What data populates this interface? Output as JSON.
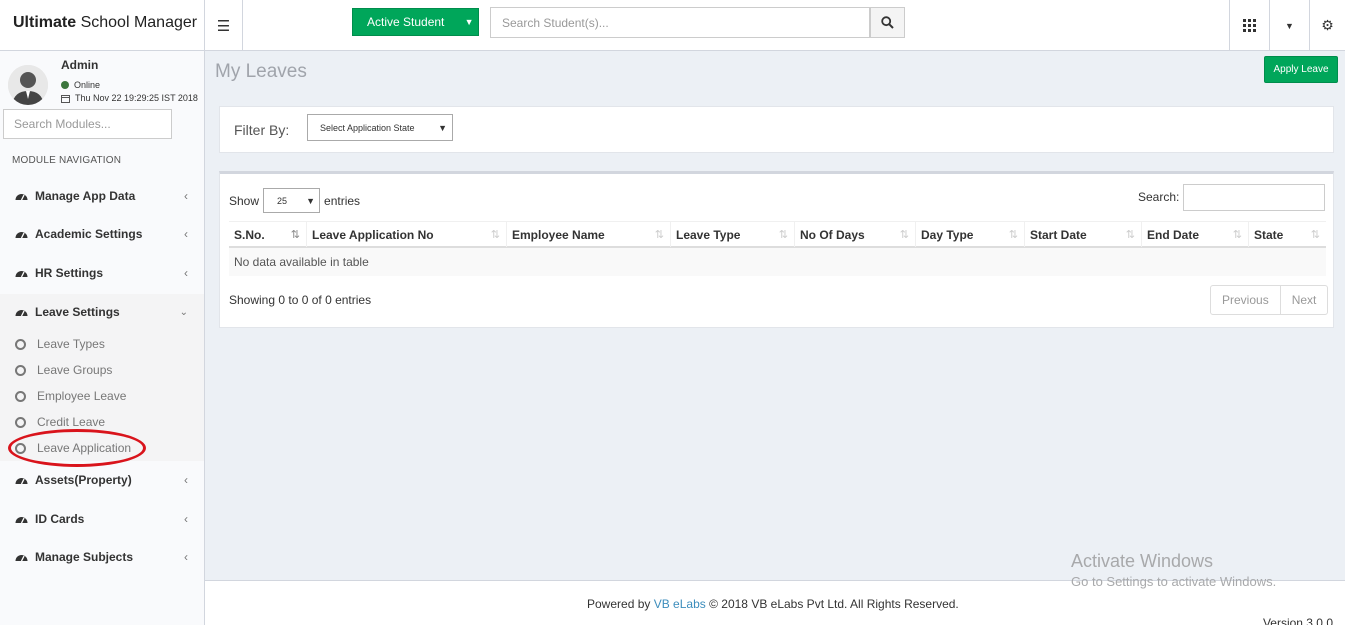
{
  "header": {
    "logo_bold": "Ultimate",
    "logo_rest": " School Manager",
    "active_button": "Active Student",
    "search_placeholder": "Search Student(s)..."
  },
  "user": {
    "name": "Admin",
    "status": "Online",
    "datetime": "Thu Nov 22 19:29:25 IST 2018"
  },
  "sidebar": {
    "search_placeholder": "Search Modules...",
    "nav_header": "MODULE NAVIGATION",
    "items": [
      {
        "label": "Manage App Data"
      },
      {
        "label": "Academic Settings"
      },
      {
        "label": "HR Settings"
      },
      {
        "label": "Leave Settings"
      },
      {
        "label": "Assets(Property)"
      },
      {
        "label": "ID Cards"
      },
      {
        "label": "Manage Subjects"
      }
    ],
    "sub_items": [
      {
        "label": "Leave Types"
      },
      {
        "label": "Leave Groups"
      },
      {
        "label": "Employee Leave"
      },
      {
        "label": "Credit Leave"
      },
      {
        "label": "Leave Application"
      }
    ]
  },
  "main": {
    "title": "My Leaves",
    "apply_button": "Apply Leave",
    "filter_label": "Filter By:",
    "filter_select": "Select Application State",
    "show_label": "Show",
    "entries_value": "25",
    "entries_label": "entries",
    "search_label": "Search:",
    "columns": [
      "S.No.",
      "Leave Application No",
      "Employee Name",
      "Leave Type",
      "No Of Days",
      "Day Type",
      "Start Date",
      "End Date",
      "State"
    ],
    "empty_message": "No data available in table",
    "info": "Showing 0 to 0 of 0 entries",
    "previous": "Previous",
    "next": "Next"
  },
  "footer": {
    "powered_by": "Powered by",
    "company_link": "VB eLabs",
    "copyright": "© 2018 VB eLabs Pvt Ltd. All Rights Reserved.",
    "version": "Version 3.0.0"
  },
  "watermark": {
    "line1": "Activate Windows",
    "line2": "Go to Settings to activate Windows."
  },
  "colors": {
    "accent_green": "#00a65a",
    "link_blue": "#3c8dbc",
    "highlight_red": "#d9141c"
  }
}
